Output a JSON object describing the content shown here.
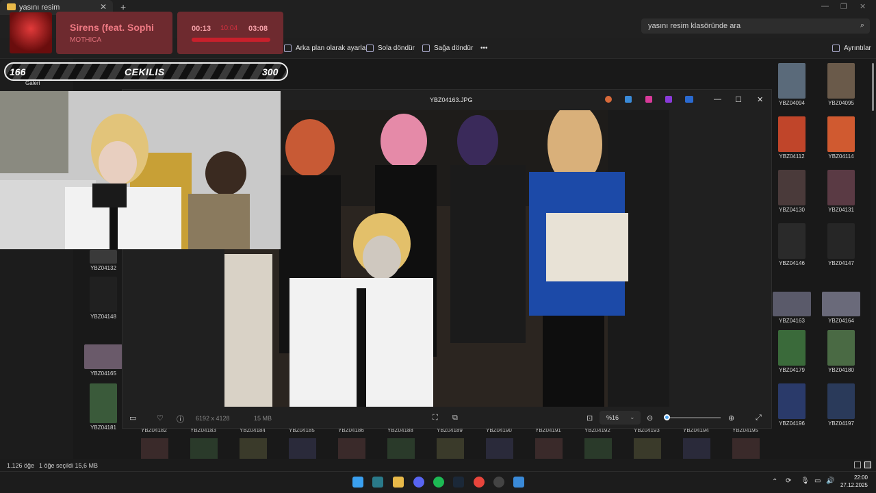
{
  "explorer": {
    "tab_title": "yasını resim",
    "search_placeholder": "yasını resim klasöründe ara",
    "commands": {
      "set_background": "Arka plan olarak ayarla",
      "rotate_left": "Sola döndür",
      "rotate_right": "Sağa döndür",
      "more": "•••",
      "details": "Ayrıntılar"
    },
    "sidebar": {
      "gallery": "Galeri"
    },
    "thumbnails_right": [
      {
        "name": "YBZ04094",
        "color": "#5a6a7a"
      },
      {
        "name": "YBZ04095",
        "color": "#6a5a4a"
      },
      {
        "name": "YBZ04112",
        "color": "#c0452a"
      },
      {
        "name": "YBZ04114",
        "color": "#d05a30"
      },
      {
        "name": "YBZ04130",
        "color": "#4a3a3a"
      },
      {
        "name": "YBZ04131",
        "color": "#5a3a44"
      },
      {
        "name": "YBZ04146",
        "color": "#2a2a2a"
      },
      {
        "name": "YBZ04147",
        "color": "#262626"
      },
      {
        "name": "YBZ04163",
        "color": "#5a5a6a"
      },
      {
        "name": "YBZ04164",
        "color": "#6a6a7a"
      },
      {
        "name": "YBZ04179",
        "color": "#3a6a3a"
      },
      {
        "name": "YBZ04180",
        "color": "#4a6a44"
      },
      {
        "name": "YBZ04196",
        "color": "#2a3a6a"
      },
      {
        "name": "YBZ04197",
        "color": "#2a3a5a"
      }
    ],
    "thumbnails_left": [
      {
        "name": "YBZ04132",
        "color": "#3a3a3a"
      },
      {
        "name": "YBZ04148",
        "color": "#202020"
      },
      {
        "name": "YBZ04165",
        "color": "#6a5a6a"
      },
      {
        "name": "YBZ04181",
        "color": "#3a5a3a"
      }
    ],
    "bottom_row_captions": [
      "YBZ04182",
      "YBZ04183",
      "YBZ04184",
      "YBZ04185",
      "YBZ04186",
      "YBZ04188",
      "YBZ04189",
      "YBZ04190",
      "YBZ04191",
      "YBZ04192",
      "YBZ04193",
      "YBZ04194",
      "YBZ04195"
    ],
    "status": {
      "count": "1.126 öğe",
      "selected": "1 öğe seçildi  15,6 MB"
    }
  },
  "viewer": {
    "title": "YBZ04163.JPG",
    "dimensions": "6192 x 4128",
    "size": "15 MB",
    "zoom": "%16"
  },
  "music": {
    "title": "Sirens (feat. Sophi",
    "artist": "MOTHICA",
    "current": "00:13",
    "middle": "10:04",
    "total": "03:08"
  },
  "giveaway": {
    "left": "166",
    "label": "CEKILIS",
    "right": "300"
  },
  "taskbar": {
    "time": "22:00",
    "date": "27.12.2025"
  }
}
